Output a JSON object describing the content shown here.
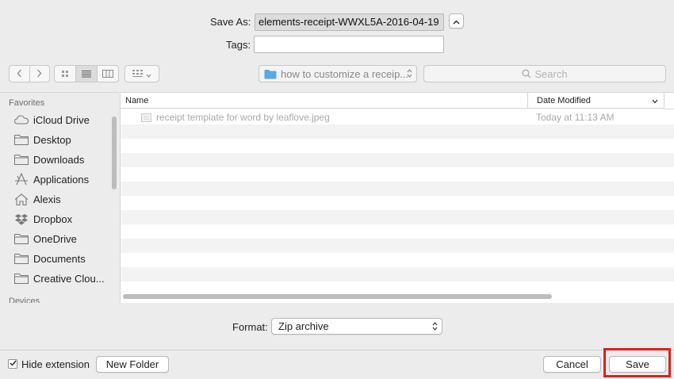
{
  "save_as": {
    "label": "Save As:",
    "value": "elements-receipt-WWXL5A-2016-04-19"
  },
  "tags": {
    "label": "Tags:",
    "value": ""
  },
  "location": {
    "folder": "how to customize a receip..."
  },
  "search": {
    "placeholder": "Search"
  },
  "sidebar": {
    "favorites_heading": "Favorites",
    "items": [
      {
        "label": "iCloud Drive",
        "icon": "cloud-icon"
      },
      {
        "label": "Desktop",
        "icon": "folder-icon"
      },
      {
        "label": "Downloads",
        "icon": "folder-icon"
      },
      {
        "label": "Applications",
        "icon": "applications-icon"
      },
      {
        "label": "Alexis",
        "icon": "home-icon"
      },
      {
        "label": "Dropbox",
        "icon": "dropbox-icon"
      },
      {
        "label": "OneDrive",
        "icon": "folder-icon"
      },
      {
        "label": "Documents",
        "icon": "folder-icon"
      },
      {
        "label": "Creative Clou...",
        "icon": "folder-icon"
      }
    ],
    "devices_heading": "Devices"
  },
  "file_list": {
    "columns": {
      "name": "Name",
      "date": "Date Modified"
    },
    "rows": [
      {
        "name": "receipt template for word by leaflove.jpeg",
        "date": "Today at 11:13 AM"
      }
    ]
  },
  "format": {
    "label": "Format:",
    "value": "Zip archive"
  },
  "bottom": {
    "hide_extension": "Hide extension",
    "hide_extension_checked": true,
    "new_folder": "New Folder",
    "cancel": "Cancel",
    "save": "Save"
  },
  "colors": {
    "highlight": "#e0201b",
    "folder_blue": "#5aa9e6"
  }
}
